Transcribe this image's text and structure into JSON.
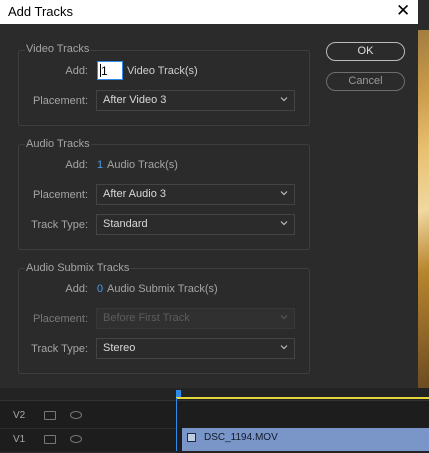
{
  "dialog": {
    "title": "Add Tracks",
    "close_glyph": "✕"
  },
  "video_tracks": {
    "title": "Video Tracks",
    "add_label": "Add:",
    "add_value": "1",
    "add_suffix": "Video Track(s)",
    "placement_label": "Placement:",
    "placement_value": "After Video 3"
  },
  "audio_tracks": {
    "title": "Audio Tracks",
    "add_label": "Add:",
    "add_value": "1",
    "add_suffix": "Audio Track(s)",
    "placement_label": "Placement:",
    "placement_value": "After Audio 3",
    "type_label": "Track Type:",
    "type_value": "Standard"
  },
  "submix_tracks": {
    "title": "Audio Submix Tracks",
    "add_label": "Add:",
    "add_value": "0",
    "add_suffix": "Audio Submix Track(s)",
    "placement_label": "Placement:",
    "placement_value": "Before First Track",
    "type_label": "Track Type:",
    "type_value": "Stereo"
  },
  "buttons": {
    "ok": "OK",
    "cancel": "Cancel"
  },
  "timeline": {
    "tracks": [
      {
        "label": "V2"
      },
      {
        "label": "V1"
      }
    ],
    "clip_name": "DSC_1194.MOV"
  },
  "colors": {
    "accent": "#2d8ceb",
    "value_blue": "#4d9be6",
    "clip": "#7a96c8",
    "work_area": "#e4d53b"
  }
}
